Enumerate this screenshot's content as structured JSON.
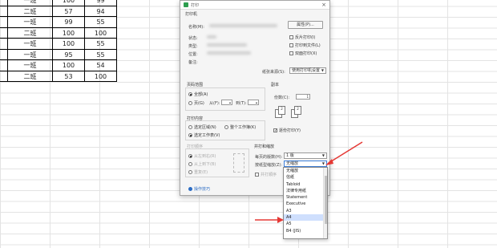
{
  "sheet": {
    "rows": [
      [
        "",
        "一班",
        "100",
        "99"
      ],
      [
        "",
        "二班",
        "57",
        "94"
      ],
      [
        "",
        "一班",
        "99",
        "55"
      ],
      [
        "",
        "二班",
        "100",
        "100"
      ],
      [
        "",
        "一班",
        "100",
        "55"
      ],
      [
        "",
        "一班",
        "95",
        "55"
      ],
      [
        "",
        "一班",
        "100",
        "54"
      ],
      [
        "",
        "二班",
        "53",
        "100"
      ]
    ]
  },
  "dialog": {
    "title": "打印",
    "printer_section": "打印机",
    "name_label": "名称(M):",
    "properties_button": "属性(P)...",
    "status_label": "状态:",
    "type_label": "类型:",
    "location_label": "位置:",
    "comment_label": "备注:",
    "reverse_print": "反片打印(I)",
    "print_to_file": "打印到文件(L)",
    "duplex": "双面打印(X)",
    "paper_source_label": "纸张来源(S):",
    "paper_source_value": "使用打印机设置",
    "page_range_title": "页码范围",
    "all_pages": "全部(A)",
    "pages_from": "页(G)",
    "from_label": "从(F):",
    "to_label": "到(T):",
    "copies_title": "副本",
    "copies_label": "份数(C):",
    "copies_value": "1",
    "collate": "逐份打印(Y)",
    "print_content_title": "打印内容",
    "selection": "选定区域(N)",
    "whole_workbook": "整个工作簿(K)",
    "selected_sheets": "选定工作表(V)",
    "print_order_title": "打印顺序",
    "order_left_right": "从左到右(R)",
    "order_top_bottom": "从上到下(B)",
    "repeat": "重复(E)",
    "merge_title": "并打和缩放",
    "pages_per_sheet_label": "每页的版数(H):",
    "pages_per_sheet_value": "1 版",
    "scale_label": "按纸型缩放(Z):",
    "scale_value": "无缩放",
    "merge_print": "并打顺序",
    "tips_link": "操作技巧",
    "ok_button": "确定",
    "cancel_button": "取消"
  },
  "dropdown": {
    "items": [
      "无缩放",
      "信纸",
      "Tabloid",
      "法律专用纸",
      "Statement",
      "Executive",
      "A3",
      "A4",
      "A5",
      "B4 (JIS)"
    ],
    "selected_index": 7
  },
  "colors": {
    "arrow": "#e53935",
    "highlight": "#cfdffd"
  }
}
